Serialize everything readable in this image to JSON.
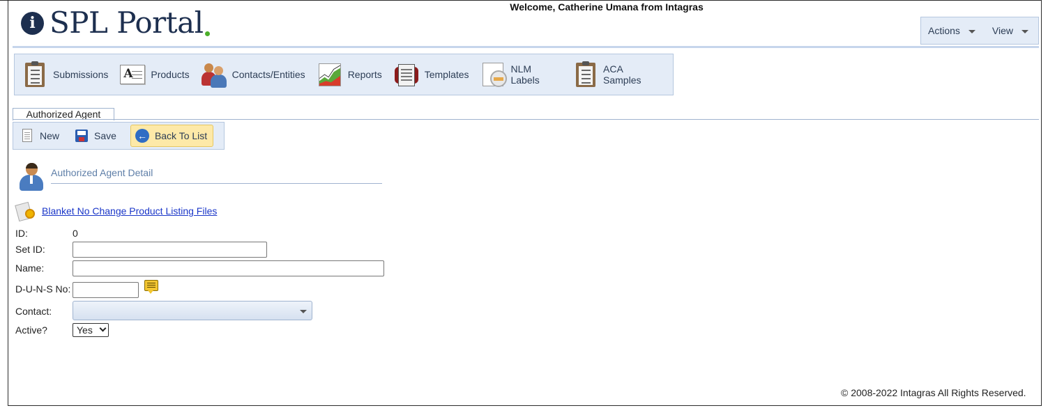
{
  "header": {
    "logo_badge": "i",
    "logo_text": "SPL Portal",
    "welcome": "Welcome, Catherine Umana from Intagras",
    "menu": {
      "actions": "Actions",
      "view": "View"
    }
  },
  "toolbar": {
    "items": [
      {
        "label": "Submissions",
        "icon": "clipboard-icon"
      },
      {
        "label": "Products",
        "icon": "products-icon"
      },
      {
        "label": "Contacts/Entities",
        "icon": "contacts-icon"
      },
      {
        "label": "Reports",
        "icon": "reports-chart-icon"
      },
      {
        "label": "Templates",
        "icon": "templates-icon"
      },
      {
        "label": "NLM Labels",
        "icon": "nlm-labels-icon"
      },
      {
        "label": "ACA Samples",
        "icon": "clipboard-icon"
      }
    ]
  },
  "tab": {
    "label": "Authorized Agent"
  },
  "actions": {
    "new": "New",
    "save": "Save",
    "back": "Back To List"
  },
  "detail": {
    "title": "Authorized Agent Detail",
    "blanket_link": "Blanket No Change Product Listing Files"
  },
  "form": {
    "id_label": "ID:",
    "id_value": "0",
    "setid_label": "Set ID:",
    "setid_value": "",
    "name_label": "Name:",
    "name_value": "",
    "duns_label": "D-U-N-S No:",
    "duns_value": "",
    "contact_label": "Contact:",
    "contact_value": "",
    "active_label": "Active?",
    "active_value": "Yes"
  },
  "footer": {
    "copyright": "© 2008-2022 Intagras All Rights Reserved."
  },
  "colors": {
    "brand_navy": "#1d2f4f",
    "brand_green": "#4caf2a",
    "toolbar_bg": "#e4ecf7",
    "link": "#1a36c8"
  }
}
